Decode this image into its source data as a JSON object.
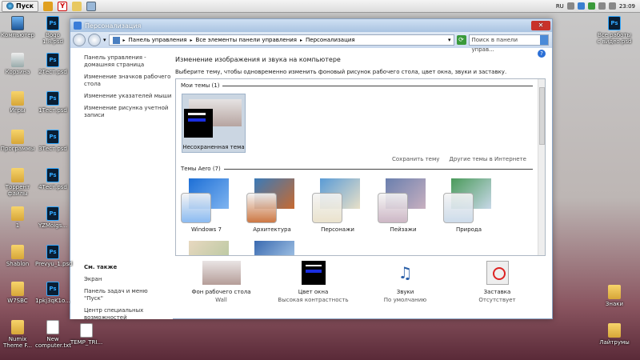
{
  "taskbar": {
    "start_label": "Пуск",
    "lang": "RU",
    "clock": "23:09"
  },
  "desktop_left": [
    {
      "label": "Компьютер",
      "kind": "pc"
    },
    {
      "label": "Корзина",
      "kind": "bin"
    },
    {
      "label": "Игры",
      "kind": "folder"
    },
    {
      "label": "Программы",
      "kind": "folder"
    },
    {
      "label": "Торрент файлы",
      "kind": "folder"
    },
    {
      "label": "1",
      "kind": "folder"
    },
    {
      "label": "Shablon",
      "kind": "folder"
    },
    {
      "label": "W7SBC",
      "kind": "folder"
    },
    {
      "label": "Numix Theme F...",
      "kind": "folder"
    }
  ],
  "desktop_col2": [
    {
      "label": "Bogo 1.8.psd",
      "kind": "ps"
    },
    {
      "label": "2Тест.psd",
      "kind": "ps"
    },
    {
      "label": "1Тест.psd",
      "kind": "ps"
    },
    {
      "label": "3Тест.psd",
      "kind": "ps"
    },
    {
      "label": "4Тест.psd",
      "kind": "ps"
    },
    {
      "label": "YZMoigs...",
      "kind": "ps"
    },
    {
      "label": "Prevyu_1.psd",
      "kind": "ps"
    },
    {
      "label": "1pkj3qK1o...",
      "kind": "ps"
    },
    {
      "label": "New computer.txt",
      "kind": "txt"
    }
  ],
  "desktop_extra": [
    {
      "label": "TEMP_TRI...",
      "kind": "txt"
    }
  ],
  "desktop_right": [
    {
      "label": "Все работы с видео.psd",
      "kind": "ps"
    },
    {
      "label": "Знаки",
      "kind": "folder"
    },
    {
      "label": "Лайтрумы",
      "kind": "folder"
    }
  ],
  "window": {
    "title": "Персонализация",
    "breadcrumb": [
      "Панель управления",
      "Все элементы панели управления",
      "Персонализация"
    ],
    "search_placeholder": "Поиск в панели управ...",
    "sidebar": {
      "links": [
        "Панель управления - домашняя страница",
        "Изменение значков рабочего стола",
        "Изменение указателей мыши",
        "Изменение рисунка учетной записи"
      ],
      "see_also_heading": "См. также",
      "see_also": [
        "Экран",
        "Панель задач и меню \"Пуск\"",
        "Центр специальных возможностей"
      ]
    },
    "main": {
      "title": "Изменение изображения и звука на компьютере",
      "description": "Выберите тему, чтобы одновременно изменить фоновый рисунок рабочего стола, цвет окна, звуки и заставку.",
      "my_themes_heading": "Мои темы (1)",
      "unsaved_theme": "Несохраненная тема",
      "save_theme": "Сохранить тему",
      "more_online": "Другие темы в Интернете",
      "aero_heading": "Темы Aero (7)",
      "aero_themes": [
        {
          "label": "Windows 7",
          "colors": [
            "#1d6fd6",
            "#7fb4f0"
          ]
        },
        {
          "label": "Архитектура",
          "colors": [
            "#3a7ab8",
            "#c86a30"
          ]
        },
        {
          "label": "Персонажи",
          "colors": [
            "#5a9bd6",
            "#e8e0c8"
          ]
        },
        {
          "label": "Пейзажи",
          "colors": [
            "#6a7fae",
            "#c8b0c0"
          ]
        },
        {
          "label": "Природа",
          "colors": [
            "#4a9a5a",
            "#c8d8e8"
          ]
        }
      ]
    },
    "bottom": [
      {
        "label": "Фон рабочего стола",
        "sub": "Wall"
      },
      {
        "label": "Цвет окна",
        "sub": "Высокая контрастность"
      },
      {
        "label": "Звуки",
        "sub": "По умолчанию"
      },
      {
        "label": "Заставка",
        "sub": "Отсутствует"
      }
    ]
  }
}
